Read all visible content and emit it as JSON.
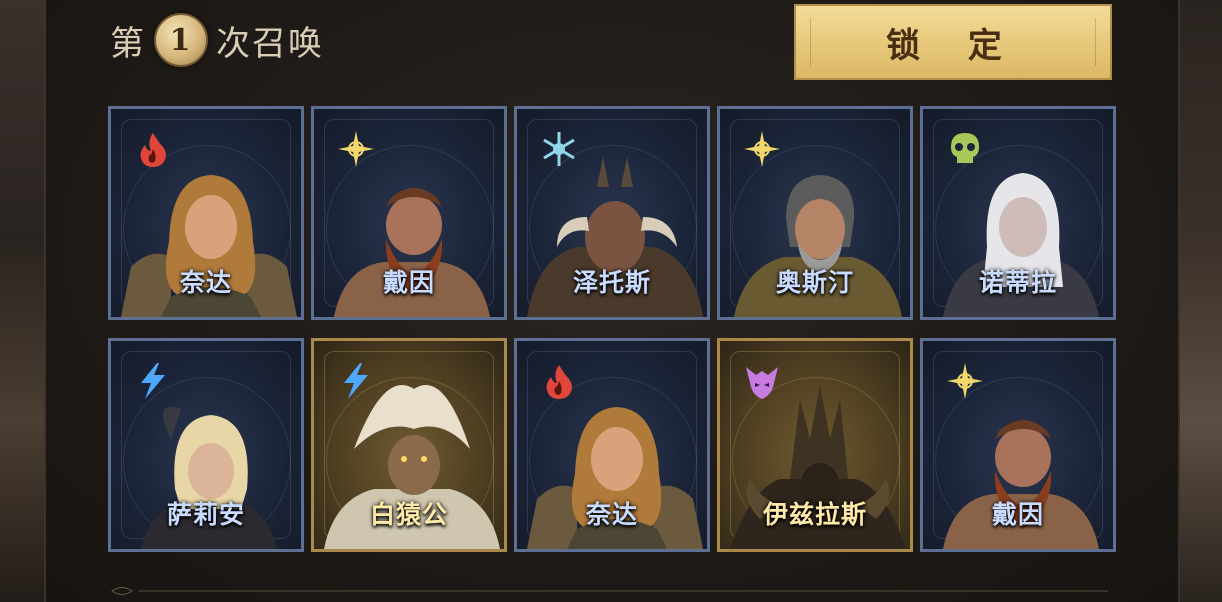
{
  "header": {
    "prefix": "第",
    "count": "1",
    "suffix": "次召唤",
    "lock_label": "锁 定"
  },
  "cards": [
    {
      "name": "奈达",
      "element": "fire-icon",
      "rarity": "normal"
    },
    {
      "name": "戴因",
      "element": "light-star-icon",
      "rarity": "normal"
    },
    {
      "name": "泽托斯",
      "element": "frost-icon",
      "rarity": "normal"
    },
    {
      "name": "奥斯汀",
      "element": "light-star-icon",
      "rarity": "normal"
    },
    {
      "name": "诺蒂拉",
      "element": "poison-skull-icon",
      "rarity": "normal"
    },
    {
      "name": "萨莉安",
      "element": "lightning-icon",
      "rarity": "normal"
    },
    {
      "name": "白猿公",
      "element": "lightning-icon",
      "rarity": "legendary"
    },
    {
      "name": "奈达",
      "element": "fire-icon",
      "rarity": "normal"
    },
    {
      "name": "伊兹拉斯",
      "element": "demon-icon",
      "rarity": "legendary"
    },
    {
      "name": "戴因",
      "element": "light-star-icon",
      "rarity": "normal"
    }
  ],
  "colors": {
    "fire": "#e0463a",
    "light": "#f2d86a",
    "frost": "#8fd6e8",
    "poison": "#a8c95a",
    "lightning": "#4fa8ff",
    "demon": "#c77be0",
    "gold_frame": "#a98a4a",
    "blue_frame": "#5d6f93"
  }
}
